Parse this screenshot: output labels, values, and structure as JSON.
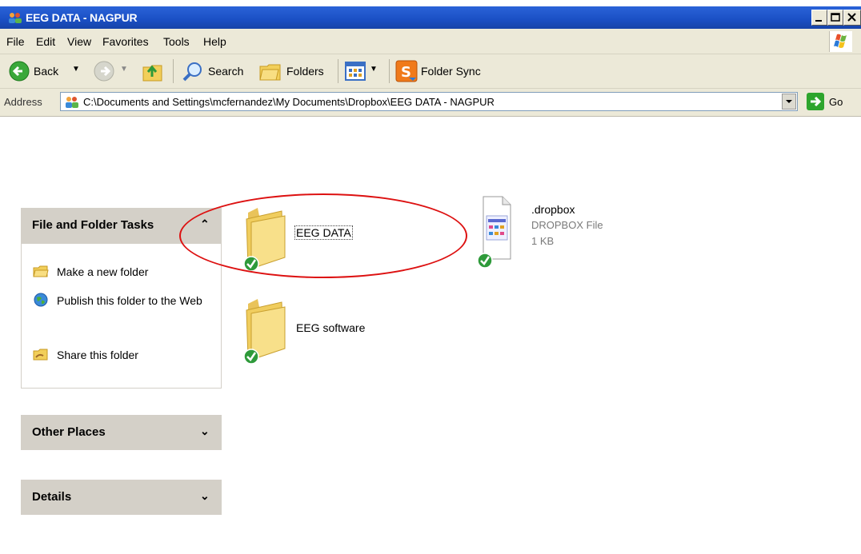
{
  "window": {
    "title": "EEG DATA - NAGPUR"
  },
  "menu": [
    "File",
    "Edit",
    "View",
    "Favorites",
    "Tools",
    "Help"
  ],
  "toolbar": {
    "back": "Back",
    "search": "Search",
    "folders": "Folders",
    "sync": "Folder Sync"
  },
  "address": {
    "label": "Address",
    "value": "C:\\Documents and Settings\\mcfernandez\\My Documents\\Dropbox\\EEG DATA - NAGPUR",
    "go": "Go"
  },
  "tasks": {
    "heading": "File and Folder Tasks",
    "items": [
      {
        "label": "Make a new folder",
        "icon": "new-folder-icon"
      },
      {
        "label": "Publish this folder to the Web",
        "icon": "globe-publish-icon"
      },
      {
        "label": "Share this folder",
        "icon": "share-folder-icon"
      }
    ]
  },
  "other_places": {
    "heading": "Other Places"
  },
  "details": {
    "heading": "Details"
  },
  "files": [
    {
      "name": "EEG DATA",
      "type": "folder",
      "synced": true,
      "selected": true
    },
    {
      "name": ".dropbox",
      "type_label": "DROPBOX File",
      "size": "1 KB",
      "synced": true
    },
    {
      "name": "EEG software",
      "type": "folder",
      "synced": true
    }
  ],
  "colors": {
    "titlebar": "#1a4fc4",
    "annotation": "#dd1111",
    "sync_badge": "#2e9a3a"
  }
}
